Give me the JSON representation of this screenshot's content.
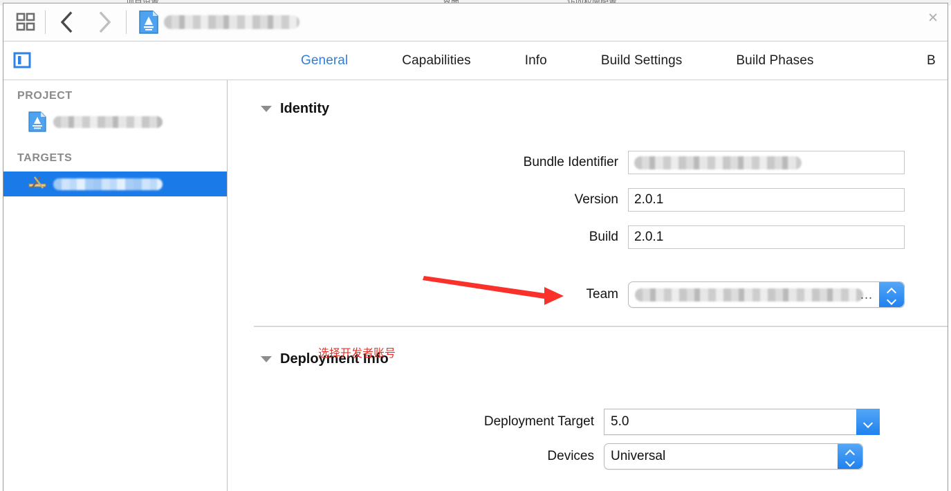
{
  "window": {
    "close_label": "✕",
    "background_ghost": [
      "项目设置",
      "界面",
      "访问权限配置"
    ]
  },
  "toolbar": {
    "grid_icon": "grid-icon",
    "back_icon": "chevron-left-icon",
    "forward_icon": "chevron-right-icon",
    "document_icon": "xcode-project-icon",
    "document_name_redacted": true
  },
  "tabbar": {
    "panel_toggle_icon": "show-left-panel-icon",
    "tabs": [
      {
        "label": "General",
        "active": true
      },
      {
        "label": "Capabilities",
        "active": false
      },
      {
        "label": "Info",
        "active": false
      },
      {
        "label": "Build Settings",
        "active": false
      },
      {
        "label": "Build Phases",
        "active": false
      },
      {
        "label": "B",
        "active": false,
        "clipped": true
      }
    ]
  },
  "sidebar": {
    "project_header": "PROJECT",
    "targets_header": "TARGETS",
    "project_items": [
      {
        "name_redacted": true,
        "icon": "xcode-project-icon",
        "selected": false
      }
    ],
    "target_items": [
      {
        "name_redacted": true,
        "icon": "xcode-target-icon",
        "selected": true
      }
    ]
  },
  "main": {
    "identity": {
      "title": "Identity",
      "fields": [
        {
          "label": "Bundle Identifier",
          "value": "",
          "redacted": true,
          "control": "textfield"
        },
        {
          "label": "Version",
          "value": "2.0.1",
          "redacted": false,
          "control": "textfield"
        },
        {
          "label": "Build",
          "value": "2.0.1",
          "redacted": false,
          "control": "textfield"
        },
        {
          "label": "Team",
          "value": "",
          "redacted": true,
          "control": "popup-updown",
          "truncation": "…"
        }
      ]
    },
    "deployment_info": {
      "title": "Deployment Info",
      "fields": [
        {
          "label": "Deployment Target",
          "value": "5.0",
          "control": "popup-down"
        },
        {
          "label": "Devices",
          "value": "Universal",
          "control": "popup-updown"
        }
      ]
    }
  },
  "annotation": {
    "text": "选择开发者账号",
    "color": "#e8332a",
    "arrow_points_to": "Team"
  },
  "colors": {
    "accent_blue": "#2f7fd8",
    "selection_blue": "#1a7be8",
    "popup_blue": "#1f82ef",
    "annotation_red": "#e8332a",
    "label_gray": "#8a8a8a"
  }
}
